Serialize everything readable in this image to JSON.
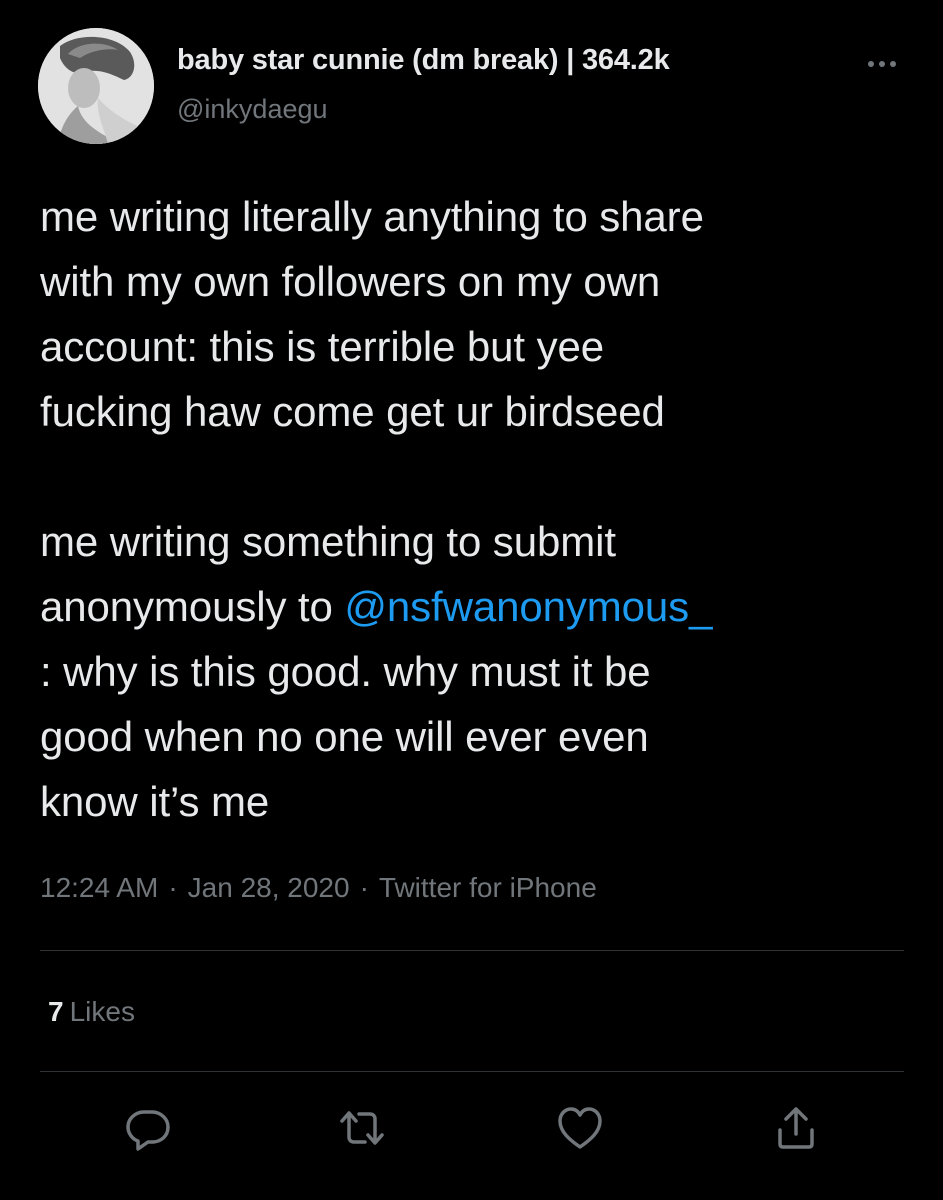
{
  "author": {
    "name": "baby star cunnie (dm break) | 364.2k",
    "handle": "@inkydaegu"
  },
  "tweet": {
    "text_part1": "me writing literally anything to share\nwith my own followers on my own\naccount: this is terrible but yee\nfucking haw come get ur birdseed\n\nme writing something to submit\nanonymously to ",
    "mention": "@nsfwanonymous_",
    "text_part2": "\n: why is this good. why must it be\ngood when no one will ever even\nknow it’s me"
  },
  "meta": {
    "time": "12:24 AM",
    "date": "Jan 28, 2020",
    "source": "Twitter for iPhone",
    "separator": "·"
  },
  "stats": {
    "likes_count": "7",
    "likes_label": "Likes"
  },
  "actions": {
    "reply_icon": "reply-icon",
    "retweet_icon": "retweet-icon",
    "like_icon": "heart-icon",
    "share_icon": "share-icon"
  },
  "colors": {
    "background": "#000000",
    "text": "#e7e9ea",
    "secondary": "#71767b",
    "link": "#1d9bf0",
    "divider": "#2f3336"
  }
}
